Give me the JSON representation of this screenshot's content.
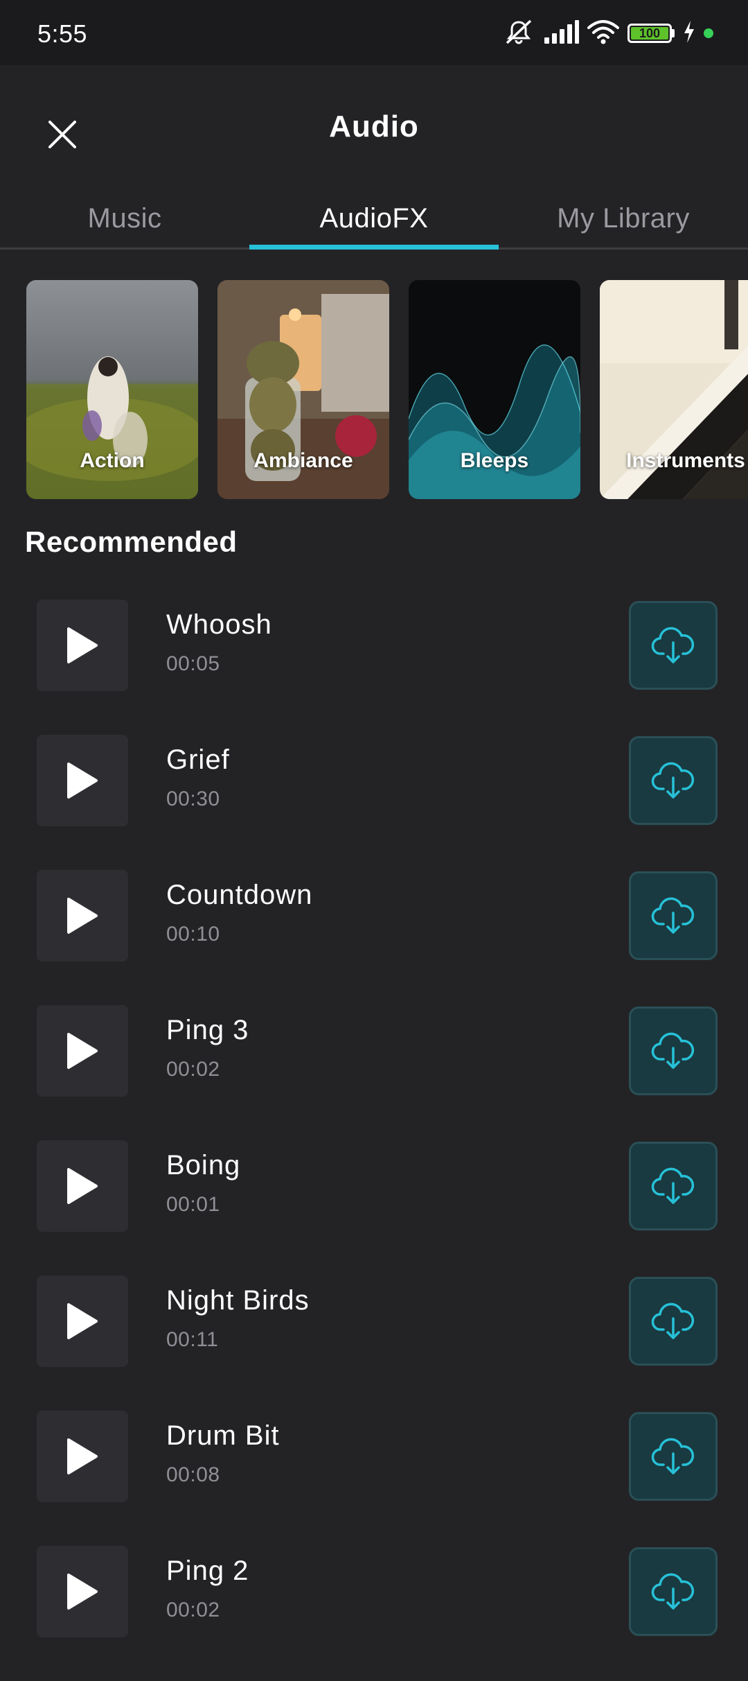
{
  "status_bar": {
    "time": "5:55",
    "battery_level": "100",
    "battery_fraction": 1.0,
    "icons": [
      "mute-icon",
      "signal-icon",
      "wifi-icon",
      "battery-icon",
      "charging-icon",
      "active-dot-icon"
    ]
  },
  "header": {
    "title": "Audio",
    "close_icon": "close-icon"
  },
  "tabs": [
    {
      "label": "Music",
      "active": false
    },
    {
      "label": "AudioFX",
      "active": true
    },
    {
      "label": "My Library",
      "active": false
    }
  ],
  "categories": [
    {
      "label": "Action"
    },
    {
      "label": "Ambiance"
    },
    {
      "label": "Bleeps"
    },
    {
      "label": "Instruments"
    }
  ],
  "section_title": "Recommended",
  "tracks": [
    {
      "name": "Whoosh",
      "duration": "00:05"
    },
    {
      "name": "Grief",
      "duration": "00:30"
    },
    {
      "name": "Countdown",
      "duration": "00:10"
    },
    {
      "name": "Ping 3",
      "duration": "00:02"
    },
    {
      "name": "Boing",
      "duration": "00:01"
    },
    {
      "name": "Night Birds",
      "duration": "00:11"
    },
    {
      "name": "Drum Bit",
      "duration": "00:08"
    },
    {
      "name": "Ping 2",
      "duration": "00:02"
    }
  ],
  "colors": {
    "background": "#232326",
    "status_bar_bg": "#1b1b1d",
    "accent": "#27c1d8",
    "download_bg": "#193a40",
    "play_bg": "#2e2e32",
    "battery_green": "#5ec22b"
  }
}
